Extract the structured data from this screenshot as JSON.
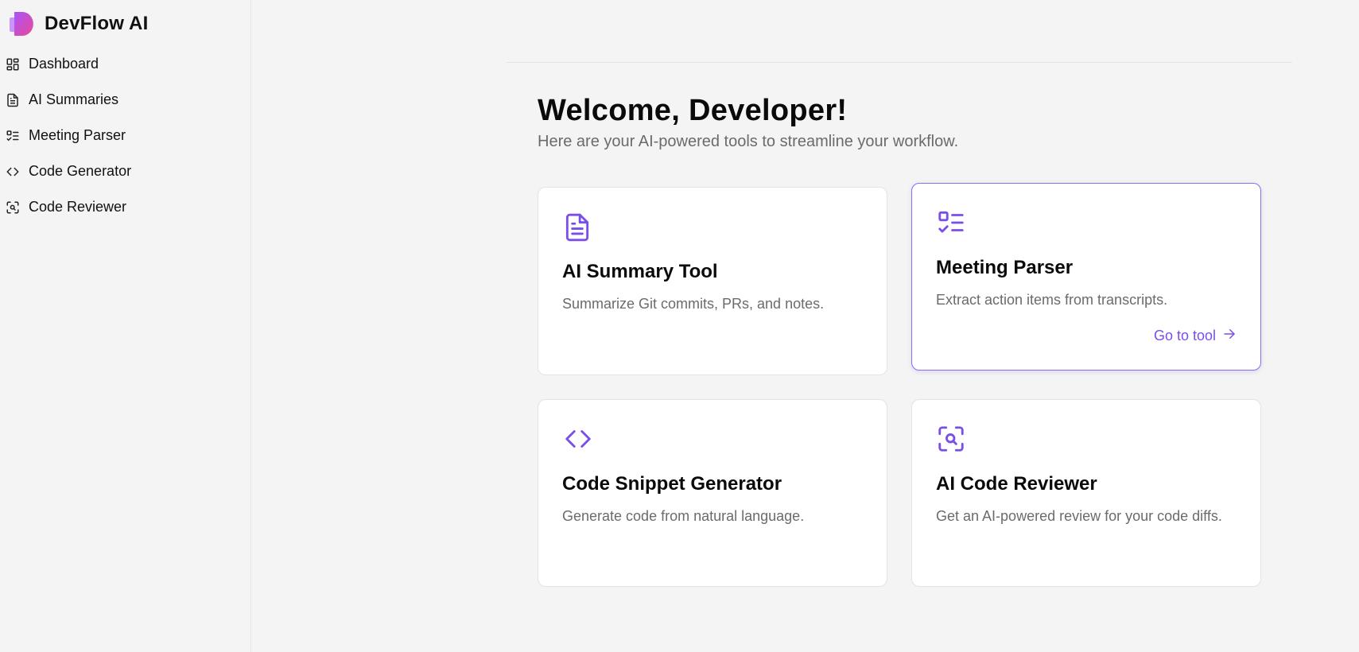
{
  "app": {
    "title": "DevFlow AI",
    "accent": "#7a4fe8"
  },
  "sidebar": {
    "items": [
      {
        "label": "Dashboard",
        "icon": "dashboard-grid-icon"
      },
      {
        "label": "AI Summaries",
        "icon": "document-icon"
      },
      {
        "label": "Meeting Parser",
        "icon": "checklist-icon"
      },
      {
        "label": "Code Generator",
        "icon": "code-brackets-icon"
      },
      {
        "label": "Code Reviewer",
        "icon": "scan-search-icon"
      }
    ]
  },
  "main": {
    "title": "Welcome, Developer!",
    "subtitle": "Here are your AI-powered tools to streamline your workflow.",
    "cards": [
      {
        "title": "AI Summary Tool",
        "description": "Summarize Git commits, PRs, and notes.",
        "icon": "document-icon"
      },
      {
        "title": "Meeting Parser",
        "description": "Extract action items from transcripts.",
        "icon": "checklist-icon",
        "link": "Go to tool"
      },
      {
        "title": "Code Snippet Generator",
        "description": "Generate code from natural language.",
        "icon": "code-brackets-icon"
      },
      {
        "title": "AI Code Reviewer",
        "description": "Get an AI-powered review for your code diffs.",
        "icon": "scan-search-icon"
      }
    ]
  }
}
